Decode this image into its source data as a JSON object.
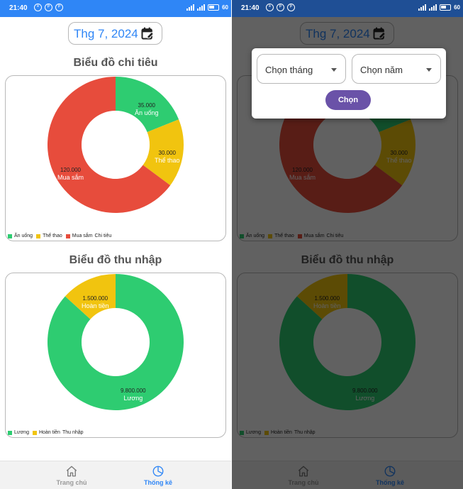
{
  "status_bar": {
    "time": "21:40",
    "battery": "60"
  },
  "date_picker": {
    "label": "Thg 7, 2024",
    "icon": "calendar-edit-icon"
  },
  "expense_chart": {
    "title": "Biểu đồ chi tiêu",
    "chart_data": {
      "type": "pie",
      "categories": [
        "Ăn uống",
        "Thể thao",
        "Mua sắm"
      ],
      "values": [
        35000,
        30000,
        120000
      ],
      "value_labels": [
        "35.000",
        "30.000",
        "120.000"
      ],
      "colors": [
        "#2ecc71",
        "#f1c40f",
        "#e74c3c"
      ],
      "legend": [
        "Ăn uống",
        "Thể thao",
        "Mua sắm"
      ],
      "legend_title": "Chi tiêu",
      "legend_position": "bottom-left"
    }
  },
  "income_chart": {
    "title": "Biểu đồ thu nhập",
    "chart_data": {
      "type": "pie",
      "categories": [
        "Lương",
        "Hoàn tiền"
      ],
      "values": [
        9800000,
        1500000
      ],
      "value_labels": [
        "9.800.000",
        "1.500.000"
      ],
      "colors": [
        "#2ecc71",
        "#f1c40f"
      ],
      "legend": [
        "Lương",
        "Hoàn tiền"
      ],
      "legend_title": "Thu nhập",
      "legend_position": "bottom-left"
    }
  },
  "bottom_nav": {
    "items": [
      {
        "label": "Trang chủ",
        "icon": "home-icon",
        "active": false
      },
      {
        "label": "Thống kê",
        "icon": "pie-chart-icon",
        "active": true
      }
    ],
    "active_color": "#2f86f6",
    "inactive_color": "#9a9a9a"
  },
  "month_year_dialog": {
    "month_placeholder": "Chọn tháng",
    "year_placeholder": "Chọn năm",
    "submit_label": "Chọn",
    "submit_color": "#6a52a8"
  }
}
